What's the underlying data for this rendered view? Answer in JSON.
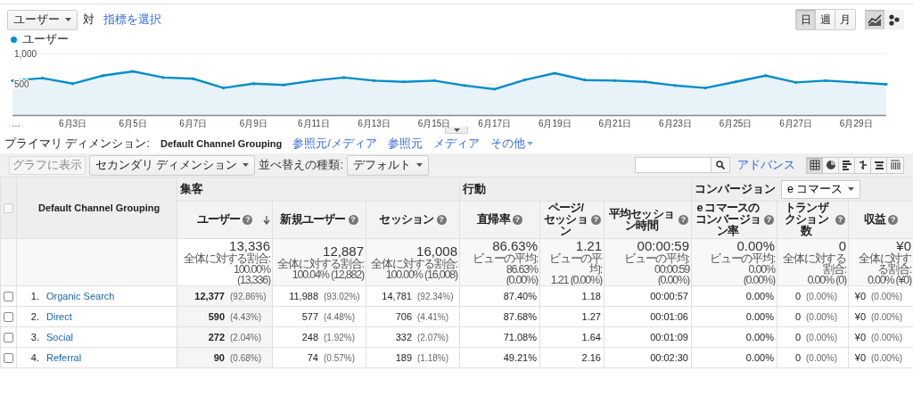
{
  "metric_bar": {
    "metric_select": "ユーザー",
    "vs_label": "対",
    "select_metric_link": "指標を選択"
  },
  "period_buttons": [
    {
      "label": "日",
      "selected": true
    },
    {
      "label": "週",
      "selected": false
    },
    {
      "label": "月",
      "selected": false
    }
  ],
  "chart_type_buttons": [
    {
      "kind": "line",
      "selected": true
    },
    {
      "kind": "motion",
      "selected": false
    }
  ],
  "chart": {
    "chart_data": {
      "type": "area",
      "categories": [
        "…",
        null,
        "6月3日",
        null,
        "6月5日",
        null,
        "6月7日",
        null,
        "6月9日",
        null,
        "6月11日",
        null,
        "6月13日",
        null,
        "6月15日",
        null,
        "6月17日",
        null,
        "6月19日",
        null,
        "6月21日",
        null,
        "6月23日",
        null,
        "6月25日",
        null,
        "6月27日",
        null,
        "6月29日",
        null
      ],
      "series": [
        {
          "name": "ユーザー",
          "color": "#058dc7",
          "values": [
            560,
            600,
            510,
            640,
            710,
            610,
            590,
            440,
            510,
            490,
            560,
            610,
            560,
            540,
            560,
            480,
            420,
            570,
            680,
            570,
            560,
            540,
            480,
            440,
            540,
            640,
            530,
            560,
            530,
            500
          ]
        }
      ],
      "ylim": [
        0,
        1000
      ],
      "yticks": [
        {
          "value": 500,
          "label": "500"
        },
        {
          "value": 1000,
          "label": "1,000"
        }
      ]
    }
  },
  "primary_dimension": {
    "label": "プライマリ ディメンション:",
    "options": [
      {
        "label": "Default Channel Grouping",
        "selected": true
      },
      {
        "label": "参照元/メディア",
        "selected": false
      },
      {
        "label": "参照元",
        "selected": false
      },
      {
        "label": "メディア",
        "selected": false
      },
      {
        "label": "その他",
        "selected": false
      }
    ]
  },
  "toolbar": {
    "plot_button": {
      "label": "グラフに表示",
      "disabled": true
    },
    "secondary_dimension": "セカンダリ ディメンション",
    "sort_label": "並べ替えの種類:",
    "sort_select": "デフォルト",
    "advanced_link": "アドバンス",
    "view_buttons": [
      {
        "kind": "table",
        "selected": true
      },
      {
        "kind": "pie",
        "selected": false
      },
      {
        "kind": "bar",
        "selected": false
      },
      {
        "kind": "compare",
        "selected": false
      },
      {
        "kind": "cloud",
        "selected": false
      },
      {
        "kind": "pivot",
        "selected": false
      }
    ]
  },
  "table": {
    "select_all": {
      "checked": false
    },
    "dimension_header": "Default Channel Grouping",
    "groups": [
      {
        "label": "集客",
        "columns": [
          {
            "label": "ユーザー",
            "help": "?",
            "sorted": true
          },
          {
            "label": "新規ユーザー",
            "help": "?",
            "sorted": false
          },
          {
            "label": "セッション",
            "help": "?",
            "sorted": false
          }
        ]
      },
      {
        "label": "行動",
        "columns": [
          {
            "label": "直帰率",
            "help": "?",
            "sorted": false
          },
          {
            "label": "ページ/セッション",
            "help": "?",
            "sorted": false
          },
          {
            "label": "平均セッション時間",
            "help": "?",
            "sorted": false
          }
        ]
      },
      {
        "label": "コンバージョン",
        "select": "e コマース",
        "columns": [
          {
            "label": "e コマースのコンバージョン率",
            "help": "?",
            "sorted": false
          },
          {
            "label": "トランザクション数",
            "help": "?",
            "sorted": false
          },
          {
            "label": "収益",
            "help": "?",
            "sorted": false
          }
        ]
      }
    ],
    "totals": [
      {
        "value": "13,336",
        "note": "全体に対する割合: 100.00%\n(13,336)"
      },
      {
        "value": "12,887",
        "note": "全体に対する割合:\n100.04% (12,882)"
      },
      {
        "value": "16,008",
        "note": "全体に対する割合:\n100.00% (16,008)"
      },
      {
        "value": "86.63%",
        "note": "ビューの平均: 86.63%\n(0.00%)"
      },
      {
        "value": "1.21",
        "note": "ビューの平均:\n1.21 (0.00%)"
      },
      {
        "value": "00:00:59",
        "note": "ビューの平均: 00:00:59\n(0.00%)"
      },
      {
        "value": "0.00%",
        "note": "ビューの平均: 0.00%\n(0.00%)"
      },
      {
        "value": "0",
        "note": "全体に対する割合:\n0.00% (0)"
      },
      {
        "value": "¥0",
        "note": "全体に対する割合:\n0.00% (¥0)"
      }
    ],
    "rows": [
      {
        "selected": false,
        "index": "1.",
        "channel": "Organic Search",
        "cells": [
          {
            "value": "12,377",
            "share": "(92.86%)"
          },
          {
            "value": "11,988",
            "share": "(93.02%)"
          },
          {
            "value": "14,781",
            "share": "(92.34%)"
          },
          {
            "value": "87.40%"
          },
          {
            "value": "1.18"
          },
          {
            "value": "00:00:57"
          },
          {
            "value": "0.00%"
          },
          {
            "value": "0",
            "share": "(0.00%)"
          },
          {
            "value": "¥0",
            "share": "(0.00%)"
          }
        ]
      },
      {
        "selected": false,
        "index": "2.",
        "channel": "Direct",
        "cells": [
          {
            "value": "590",
            "share": "(4.43%)"
          },
          {
            "value": "577",
            "share": "(4.48%)"
          },
          {
            "value": "706",
            "share": "(4.41%)"
          },
          {
            "value": "87.68%"
          },
          {
            "value": "1.27"
          },
          {
            "value": "00:01:06"
          },
          {
            "value": "0.00%"
          },
          {
            "value": "0",
            "share": "(0.00%)"
          },
          {
            "value": "¥0",
            "share": "(0.00%)"
          }
        ]
      },
      {
        "selected": false,
        "index": "3.",
        "channel": "Social",
        "cells": [
          {
            "value": "272",
            "share": "(2.04%)"
          },
          {
            "value": "248",
            "share": "(1.92%)"
          },
          {
            "value": "332",
            "share": "(2.07%)"
          },
          {
            "value": "71.08%"
          },
          {
            "value": "1.64"
          },
          {
            "value": "00:01:09"
          },
          {
            "value": "0.00%"
          },
          {
            "value": "0",
            "share": "(0.00%)"
          },
          {
            "value": "¥0",
            "share": "(0.00%)"
          }
        ]
      },
      {
        "selected": false,
        "index": "4.",
        "channel": "Referral",
        "cells": [
          {
            "value": "90",
            "share": "(0.68%)"
          },
          {
            "value": "74",
            "share": "(0.57%)"
          },
          {
            "value": "189",
            "share": "(1.18%)"
          },
          {
            "value": "49.21%"
          },
          {
            "value": "2.16"
          },
          {
            "value": "00:02:30"
          },
          {
            "value": "0.00%"
          },
          {
            "value": "0",
            "share": "(0.00%)"
          },
          {
            "value": "¥0",
            "share": "(0.00%)"
          }
        ]
      }
    ]
  }
}
